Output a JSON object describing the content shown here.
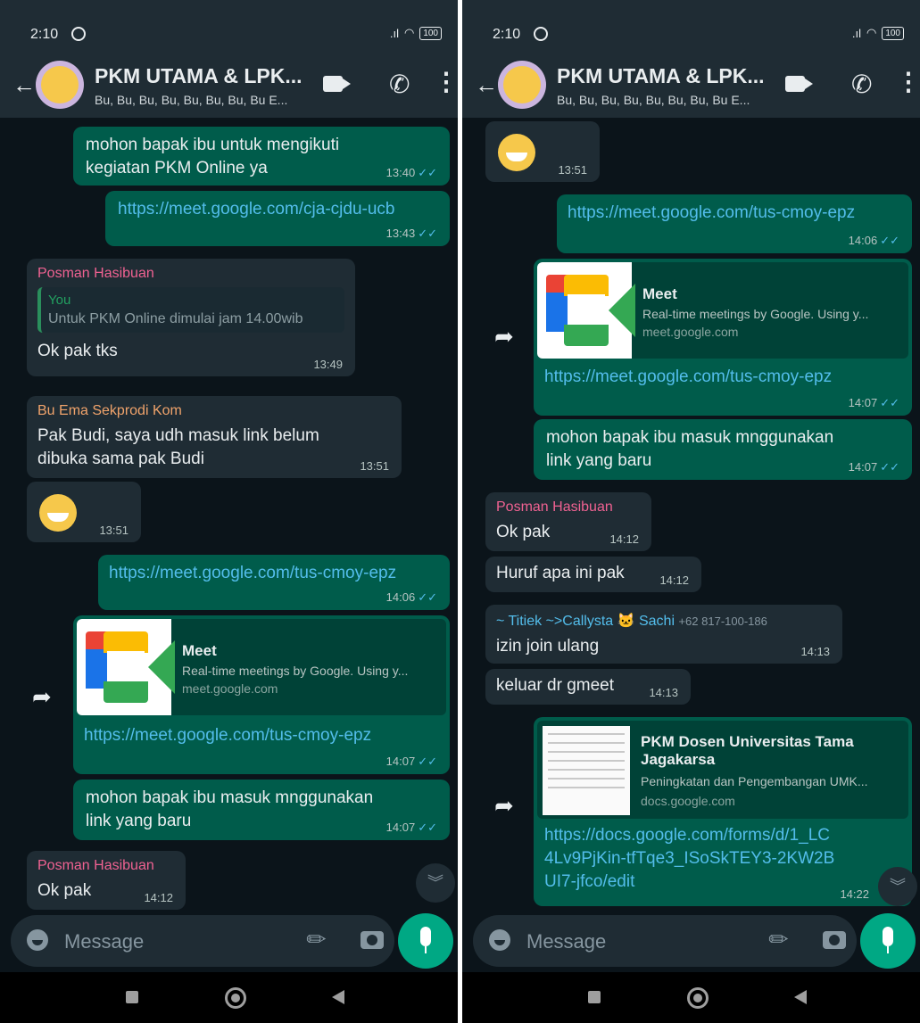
{
  "screens": {
    "left": {
      "status_bar": {
        "time": "2:10",
        "signal": ".ıl",
        "battery": "100"
      },
      "header": {
        "title": "PKM UTAMA & LPK...",
        "members": "Bu, Bu, Bu, Bu, Bu, Bu, Bu, Bu E..."
      },
      "messages": {
        "m1": {
          "text": "mohon bapak ibu untuk mengikuti kegiatan PKM Online ya",
          "time": "13:40"
        },
        "m2": {
          "text": "https://meet.google.com/cja-cjdu-ucb",
          "time": "13:43"
        },
        "m3": {
          "sender": "Posman Hasibuan",
          "quote_name": "You",
          "quote_text": "Untuk PKM Online dimulai jam 14.00wib",
          "text": "Ok pak tks",
          "time": "13:49"
        },
        "m4": {
          "sender": "Bu Ema Sekprodi Kom",
          "text": "Pak Budi, saya udh masuk link belum dibuka sama pak Budi",
          "time": "13:51"
        },
        "m5": {
          "emoji": "grinning-face",
          "time": "13:51"
        },
        "m6": {
          "text": "https://meet.google.com/tus-cmoy-epz",
          "time": "14:06"
        },
        "m7": {
          "preview_title": "Meet",
          "preview_desc": "Real-time meetings by Google. Using y...",
          "preview_domain": "meet.google.com",
          "text": "https://meet.google.com/tus-cmoy-epz",
          "time": "14:07"
        },
        "m8": {
          "text": "mohon bapak ibu masuk mnggunakan link yang baru",
          "time": "14:07"
        },
        "m9": {
          "sender": "Posman Hasibuan",
          "text": "Ok pak",
          "time": "14:12"
        }
      },
      "input": {
        "placeholder": "Message"
      }
    },
    "right": {
      "status_bar": {
        "time": "2:10",
        "signal": ".ıl",
        "battery": "100"
      },
      "header": {
        "title": "PKM UTAMA & LPK...",
        "members": "Bu, Bu, Bu, Bu, Bu, Bu, Bu, Bu E..."
      },
      "messages": {
        "m1": {
          "emoji": "grinning-face",
          "time": "13:51"
        },
        "m2": {
          "text": "https://meet.google.com/tus-cmoy-epz",
          "time": "14:06"
        },
        "m3": {
          "preview_title": "Meet",
          "preview_desc": "Real-time meetings by Google. Using y...",
          "preview_domain": "meet.google.com",
          "text": "https://meet.google.com/tus-cmoy-epz",
          "time": "14:07"
        },
        "m4": {
          "text": "mohon bapak ibu masuk mnggunakan link yang baru",
          "time": "14:07"
        },
        "m5": {
          "sender": "Posman Hasibuan",
          "text": "Ok pak",
          "time": "14:12"
        },
        "m6": {
          "text": "Huruf apa ini pak",
          "time": "14:12"
        },
        "m7": {
          "sender": "~ Titiek ~>Callysta 🐱 Sachi",
          "phone": "+62 817-100-186",
          "text": "izin join ulang",
          "time": "14:13"
        },
        "m8": {
          "text": "keluar dr gmeet",
          "time": "14:13"
        },
        "m9": {
          "preview_title": "PKM Dosen Universitas Tama Jagakarsa",
          "preview_desc": "Peningkatan dan Pengembangan UMK...",
          "preview_domain": "docs.google.com",
          "text": "https://docs.google.com/forms/d/1_LC4Lv9PjKin-tfTqe3_ISoSkTEY3-2KW2BUI7-jfco/edit",
          "time": "14:22"
        }
      },
      "input": {
        "placeholder": "Message"
      }
    }
  },
  "colors": {
    "outgoing_bubble": "#005c4b",
    "incoming_bubble": "#1f2c34",
    "background": "#0b141a",
    "accent": "#00a884",
    "link": "#53bdeb",
    "read_ticks": "#53bdeb",
    "sender_pink": "#f06292",
    "sender_orange": "#f0a36b"
  },
  "icons": [
    "back-arrow-icon",
    "video-call-icon",
    "voice-call-icon",
    "more-menu-icon",
    "forward-icon",
    "scroll-down-icon",
    "emoji-icon",
    "attach-icon",
    "camera-icon",
    "mic-icon",
    "alarm-icon",
    "wifi-icon",
    "battery-icon",
    "nav-recent-icon",
    "nav-home-icon",
    "nav-back-icon"
  ]
}
